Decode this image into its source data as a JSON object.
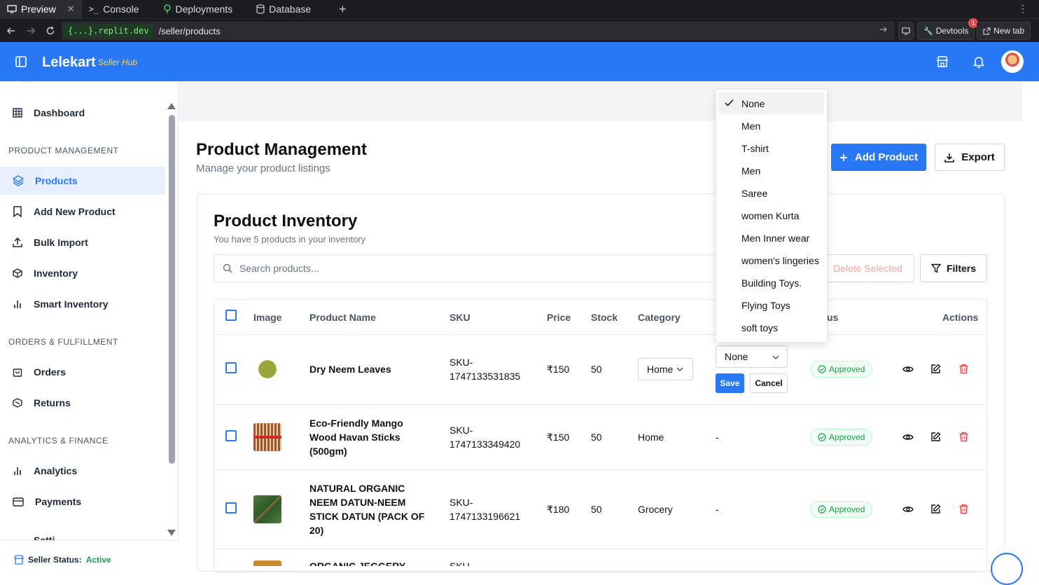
{
  "browser": {
    "tabs": [
      {
        "label": "Preview",
        "close": "✕"
      },
      {
        "label": "Console"
      },
      {
        "label": "Deployments"
      },
      {
        "label": "Database"
      }
    ],
    "url_host": "{...}.replit.dev",
    "url_path": "/seller/products",
    "devtools_label": "Devtools",
    "devtools_badge": "1",
    "newtab_label": "New tab"
  },
  "header": {
    "brand": "Lelekart",
    "brand_sub": "Seller Hub"
  },
  "sidebar": {
    "dashboard": "Dashboard",
    "section_product": "PRODUCT MANAGEMENT",
    "products": "Products",
    "add_new_product": "Add New Product",
    "bulk_import": "Bulk Import",
    "inventory": "Inventory",
    "smart_inventory": "Smart Inventory",
    "section_orders": "ORDERS & FULFILLMENT",
    "orders": "Orders",
    "returns": "Returns",
    "section_analytics": "ANALYTICS & FINANCE",
    "analytics": "Analytics",
    "payments": "Payments",
    "settings_partial": "Setti",
    "seller_status_label": "Seller Status:",
    "seller_status_value": "Active"
  },
  "page": {
    "title": "Product Management",
    "subtitle": "Manage your product listings",
    "add_product": "Add Product",
    "export": "Export"
  },
  "inventory": {
    "title": "Product Inventory",
    "subtitle": "You have 5 products in your inventory",
    "search_placeholder": "Search products...",
    "delete_selected": "Delete Selected",
    "filters": "Filters"
  },
  "table": {
    "headers": {
      "image": "Image",
      "name": "Product Name",
      "sku": "SKU",
      "price": "Price",
      "stock": "Stock",
      "category": "Category",
      "status": "us",
      "actions": "Actions"
    },
    "rows": [
      {
        "name": "Dry Neem Leaves",
        "sku1": "SKU-",
        "sku2": "1747133531835",
        "price": "₹150",
        "stock": "50",
        "category": "Home",
        "subcategory": "None",
        "status": "Approved"
      },
      {
        "name1": "Eco-Friendly Mango",
        "name2": "Wood Havan Sticks",
        "name3": "(500gm)",
        "sku1": "SKU-",
        "sku2": "1747133349420",
        "price": "₹150",
        "stock": "50",
        "category": "Home",
        "subcategory": "-",
        "status": "Approved"
      },
      {
        "name1": "NATURAL ORGANIC",
        "name2": "NEEM DATUN-NEEM",
        "name3": "STICK DATUN (PACK OF",
        "name4": "20)",
        "sku1": "SKU-",
        "sku2": "1747133196621",
        "price": "₹180",
        "stock": "50",
        "category": "Grocery",
        "subcategory": "-",
        "status": "Approved"
      },
      {
        "name1": "ORGANIC JEGGERY",
        "sku1": "SKU-"
      }
    ],
    "save": "Save",
    "cancel": "Cancel"
  },
  "dropdown": {
    "options": [
      "None",
      "Men",
      "T-shirt",
      "Men",
      "Saree",
      "women Kurta",
      "Men Inner wear",
      "women's lingeries",
      "Building Toys.",
      "Flying Toys",
      "soft toys"
    ],
    "selected": "None"
  },
  "colors": {
    "brand_blue": "#2979f7",
    "approved_green": "#16a34a",
    "danger_red": "#e5484d"
  }
}
